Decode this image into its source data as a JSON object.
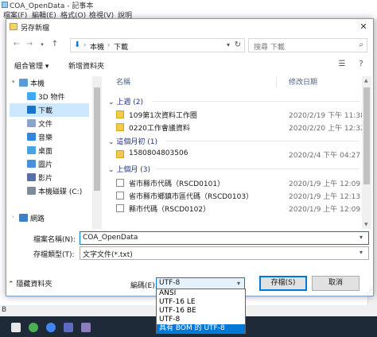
{
  "background_window": {
    "title": "COA_OpenData - 記事本",
    "menu": [
      "檔案(F)",
      "編輯(E)",
      "格式(O)",
      "檢視(V)",
      "說明"
    ],
    "status_text": "B"
  },
  "dialog": {
    "title": "另存新檔",
    "close_label": "✕",
    "address": {
      "crumbs": [
        "本機",
        "下載"
      ]
    },
    "search": {
      "placeholder": "搜尋 下載"
    },
    "toolbar": {
      "organize_label": "組合管理 ▾",
      "new_folder_label": "新增資料夾",
      "help_label": "?"
    },
    "nav_items": [
      {
        "label": "本機",
        "icon": "computer-icon",
        "color": "#5b9bd5"
      },
      {
        "label": "3D 物件",
        "icon": "cube-icon",
        "color": "#3fa9f5"
      },
      {
        "label": "下載",
        "icon": "download-icon",
        "color": "#1a73c8"
      },
      {
        "label": "文件",
        "icon": "document-icon",
        "color": "#8aa5c8"
      },
      {
        "label": "音樂",
        "icon": "music-icon",
        "color": "#2e86de"
      },
      {
        "label": "桌面",
        "icon": "desktop-icon",
        "color": "#4aa3df"
      },
      {
        "label": "圖片",
        "icon": "picture-icon",
        "color": "#4a90d9"
      },
      {
        "label": "影片",
        "icon": "video-icon",
        "color": "#5a6fa8"
      },
      {
        "label": "本機磁碟 (C:)",
        "icon": "drive-icon",
        "color": "#7f8c99"
      },
      {
        "label": "網路",
        "icon": "network-icon",
        "color": "#3d7fc4"
      }
    ],
    "columns": {
      "name": "名稱",
      "modified": "修改日期"
    },
    "groups": [
      {
        "label": "上週 (2)",
        "rows": [
          {
            "name": "109第1次資料工作圈",
            "date": "2020/2/19 下午 11:38",
            "type": "folder"
          },
          {
            "name": "0220工作會議資料",
            "date": "2020/2/20 上午 12:32",
            "type": "folder"
          }
        ]
      },
      {
        "label": "這個月初 (1)",
        "rows": [
          {
            "name": "1580804803506",
            "date": "2020/2/4 下午 04:27",
            "type": "folder"
          }
        ]
      },
      {
        "label": "上個月 (3)",
        "rows": [
          {
            "name": "省市縣市代碼（RSCD0101）",
            "date": "2020/1/9 上午 12:09",
            "type": "doc"
          },
          {
            "name": "省市縣市鄉鎮市區代碼（RSCD0103）",
            "date": "2020/1/9 上午 12:13",
            "type": "doc"
          },
          {
            "name": "縣市代碼（RSCD0102）",
            "date": "2020/1/9 上午 12:09",
            "type": "doc"
          }
        ]
      }
    ],
    "filename_label": "檔案名稱(N):",
    "filename_value": "COA_OpenData",
    "filetype_label": "存檔類型(T):",
    "filetype_value": "文字文件(*.txt)",
    "hide_folders_label": "⌃ 隱藏資料夾",
    "encoding_label": "編碼(E):",
    "encoding_value": "UTF-8",
    "save_label": "存檔(S)",
    "cancel_label": "取消"
  },
  "encoding_options": [
    "ANSI",
    "UTF-16 LE",
    "UTF-16 BE",
    "UTF-8",
    "具有 BOM 的 UTF-8"
  ],
  "colors": {
    "accent": "#0078d7",
    "selection": "#cce8ff",
    "group_text": "#1e3287"
  }
}
